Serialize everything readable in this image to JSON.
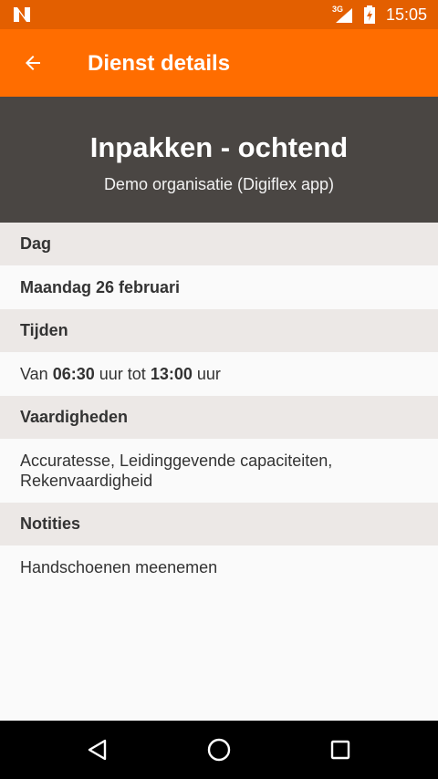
{
  "status_bar": {
    "time": "15:05",
    "network": "3G",
    "colors": {
      "background": "#e35f00"
    },
    "icons": [
      "n-notification-icon",
      "signal-icon",
      "battery-icon"
    ]
  },
  "app_bar": {
    "title": "Dienst details",
    "back_icon": "arrow-left-icon",
    "colors": {
      "background": "#ff6d00"
    }
  },
  "header": {
    "title": "Inpakken - ochtend",
    "organization": "Demo organisatie (Digiflex app)",
    "colors": {
      "background": "#4a4643"
    }
  },
  "sections": {
    "day": {
      "label": "Dag",
      "value": "Maandag 26 februari"
    },
    "times": {
      "label": "Tijden",
      "prefix": "Van",
      "start": "06:30",
      "middle": "uur tot",
      "end": "13:00",
      "suffix": "uur"
    },
    "skills": {
      "label": "Vaardigheden",
      "line1": "Accuratesse, Leidinggevende capaciteiten,",
      "line2": "Rekenvaardigheid"
    },
    "notes": {
      "label": "Notities",
      "value": "Handschoenen meenemen"
    }
  },
  "nav_bar": {
    "icons": [
      "back-triangle-icon",
      "home-circle-icon",
      "recents-square-icon"
    ]
  }
}
